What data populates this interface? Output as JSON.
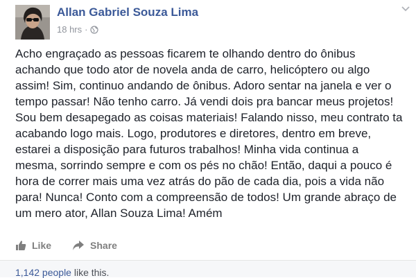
{
  "post": {
    "author": "Allan Gabriel Souza Lima",
    "time": "18 hrs",
    "separator": "·",
    "icons": {
      "audience": "globe-icon",
      "options": "chevron-down-icon",
      "like": "thumbs-up-icon",
      "share": "share-arrow-icon"
    },
    "body": "Acho engraçado as pessoas ficarem te olhando dentro do ônibus\nachando que todo ator de novela anda de carro, helicóptero ou algo\nassim! Sim, continuo andando de ônibus. Adoro sentar na janela e ver o\ntempo passar! Não tenho carro. Já vendi dois pra bancar meus projetos!\nSou bem desapegado as coisas materiais! Falando nisso, meu contrato ta\nacabando logo mais. Logo, produtores e diretores, dentro em breve,\nestarei a disposição para futuros trabalhos! Minha vida continua a\nmesma, sorrindo sempre e com os pés no chão! Então, daqui a pouco é\nhora de correr mais uma vez atrás do pão de cada dia, pois a vida não\npara! Nunca! Conto com a compreensão de todos! Um grande abraço de\num mero ator, Allan Souza Lima! Amém"
  },
  "actions": {
    "like_label": "Like",
    "share_label": "Share"
  },
  "likes": {
    "count_link": "1,142 people",
    "suffix": " like this."
  },
  "colors": {
    "name_blue": "#3b5998",
    "meta_gray": "#90949c",
    "body_text": "#1d2129",
    "action_gray": "#7f7f7f"
  }
}
